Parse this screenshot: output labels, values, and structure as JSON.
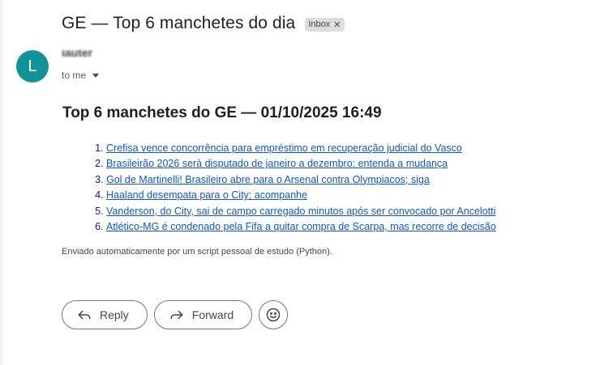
{
  "subject": "GE — Top 6 manchetes do dia",
  "label": {
    "name": "Inbox",
    "remove_icon": "close-icon"
  },
  "sender": {
    "avatar_letter": "L",
    "name": "lauter",
    "recipient": "to me"
  },
  "body": {
    "title": "Top 6 manchetes do GE — 01/10/2025 16:49",
    "headlines": [
      "Crefisa vence concorrência para empréstimo em recuperação judicial do Vasco",
      "Brasileirão 2026 será disputado de janeiro a dezembro: entenda a mudança",
      "Gol de Martinelli! Brasileiro abre para o Arsenal contra Olympiacos; siga",
      "Haaland desempata para o City; acompanhe",
      "Vanderson, do City, sai de campo carregado minutos após ser convocado por Ancelotti",
      "Atlético-MG é condenado pela Fifa a quitar compra de Scarpa, mas recorre de decisão"
    ],
    "footnote": "Enviado automaticamente por um script pessoal de estudo (Python)."
  },
  "actions": {
    "reply_label": "Reply",
    "forward_label": "Forward",
    "reply_icon": "reply-icon",
    "forward_icon": "forward-icon",
    "emoji_icon": "emoji-reaction-icon"
  },
  "colors": {
    "avatar": "#12939a",
    "link": "#1155cc",
    "chip_bg": "#dddddd"
  }
}
